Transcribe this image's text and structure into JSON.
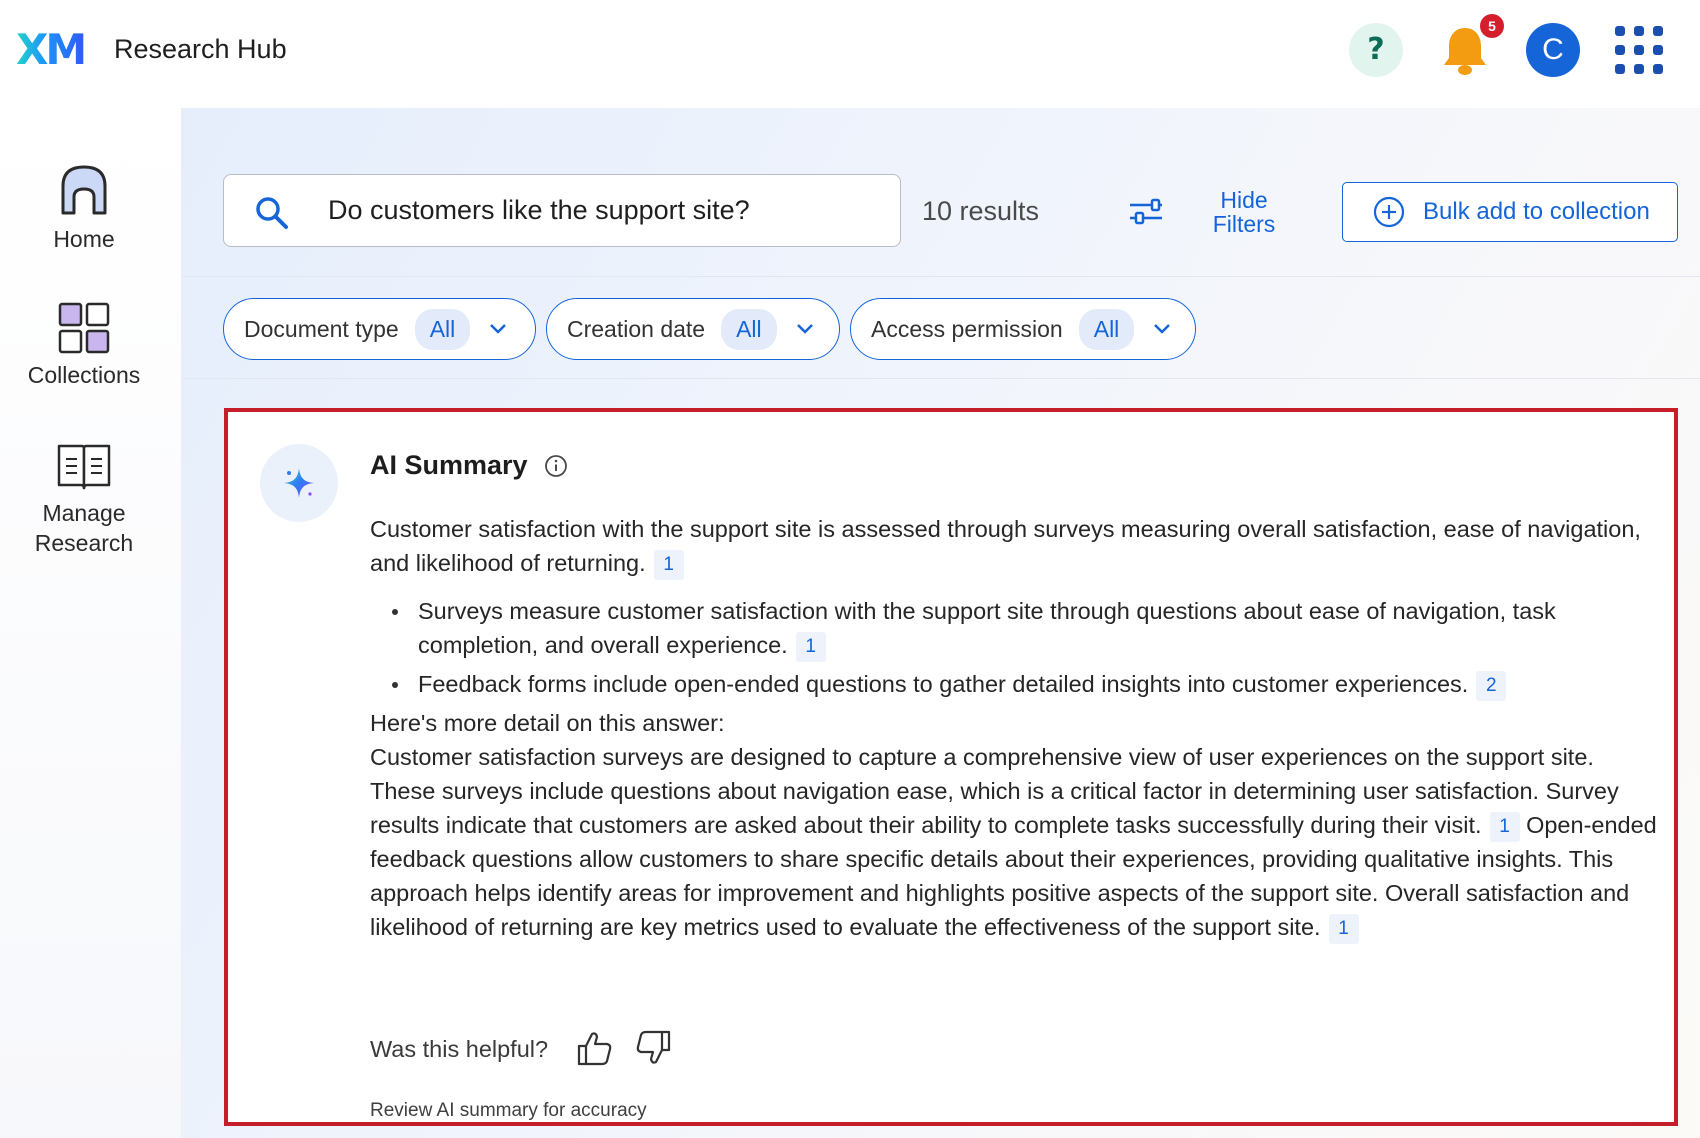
{
  "header": {
    "logo": "XM",
    "app_title": "Research Hub",
    "help_label": "?",
    "notification_count": "5",
    "avatar_initial": "C"
  },
  "sidenav": {
    "items": [
      {
        "label": "Home",
        "icon": "home-icon"
      },
      {
        "label": "Collections",
        "icon": "collections-icon"
      },
      {
        "label": "Manage Research",
        "icon": "book-icon"
      }
    ]
  },
  "search": {
    "value": "Do customers like the support site?",
    "results_count": "10 results",
    "hide_filters_label_1": "Hide",
    "hide_filters_label_2": "Filters",
    "bulk_add_label": "Bulk add to collection"
  },
  "filters": [
    {
      "label": "Document type",
      "value": "All"
    },
    {
      "label": "Creation date",
      "value": "All"
    },
    {
      "label": "Access permission",
      "value": "All"
    }
  ],
  "summary": {
    "title": "AI Summary",
    "intro": "Customer satisfaction with the support site is assessed through surveys measuring overall satisfaction, ease of navigation, and likelihood of returning.",
    "intro_cite": "1",
    "bullets": [
      {
        "text": "Surveys measure customer satisfaction with the support site through questions about ease of navigation, task completion, and overall experience.",
        "cite": "1"
      },
      {
        "text": "Feedback forms include open-ended questions to gather detailed insights into customer experiences.",
        "cite": "2"
      }
    ],
    "detail_heading": "Here's more detail on this answer:",
    "detail_part1": "Customer satisfaction surveys are designed to capture a comprehensive view of user experiences on the support site. These surveys include questions about navigation ease, which is a critical factor in determining user satisfaction. Survey results indicate that customers are asked about their ability to complete tasks successfully during their visit.",
    "detail_cite1": "1",
    "detail_part2": "Open-ended feedback questions allow customers to share specific details about their experiences, providing qualitative insights. This approach helps identify areas for improvement and highlights positive aspects of the support site. Overall satisfaction and likelihood of returning are key metrics used to evaluate the effectiveness of the support site.",
    "detail_cite2": "1",
    "helpful_prompt": "Was this helpful?",
    "disclaimer": "Review AI summary for accuracy"
  },
  "colors": {
    "accent": "#1565d8",
    "highlight_border": "#c41e2b",
    "badge": "#d41e2c",
    "bell": "#f39c12"
  }
}
